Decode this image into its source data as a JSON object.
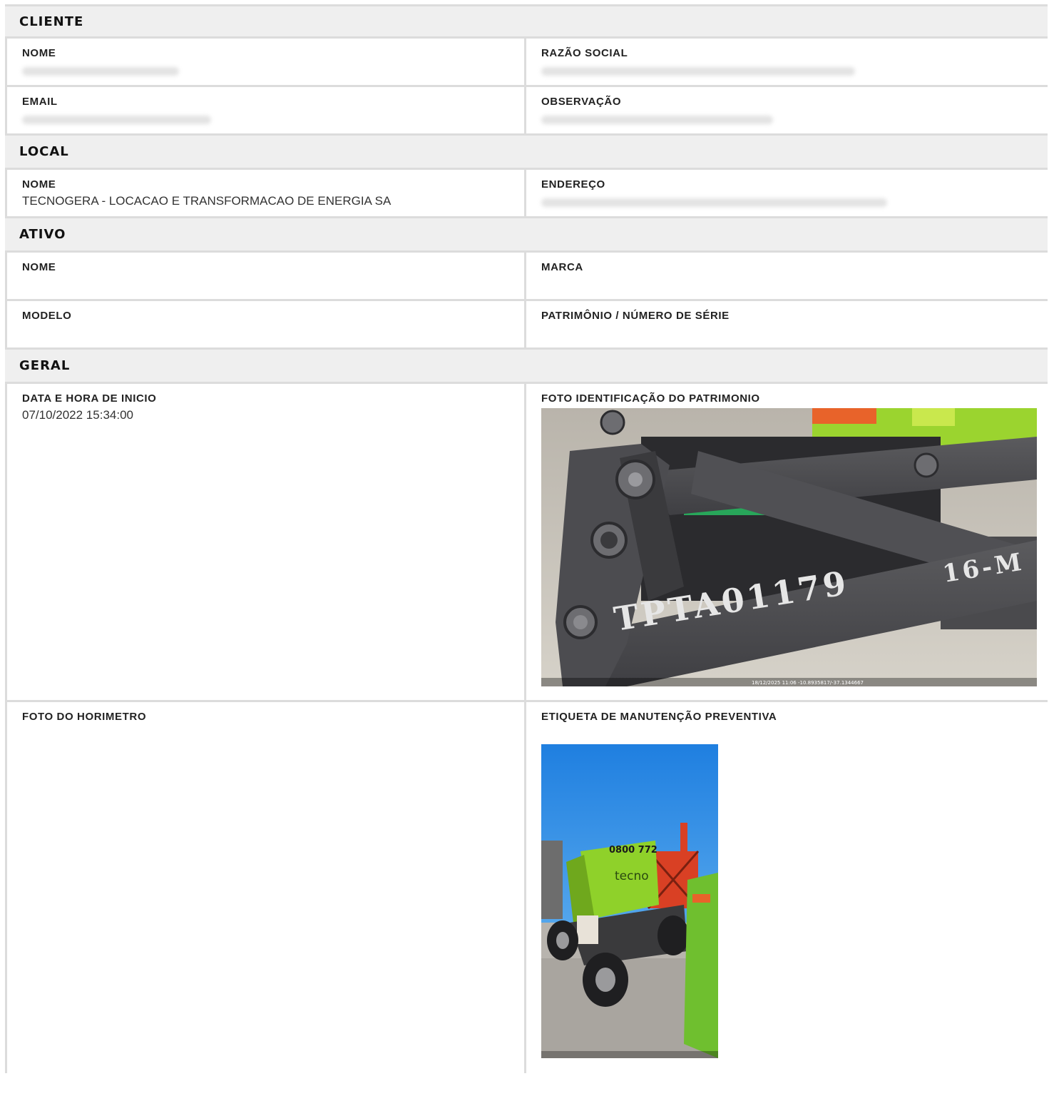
{
  "cliente": {
    "title": "CLIENTE",
    "nome_label": "NOME",
    "razao_label": "RAZÃO SOCIAL",
    "email_label": "EMAIL",
    "obs_label": "OBSERVAÇÃO"
  },
  "local": {
    "title": "LOCAL",
    "nome_label": "NOME",
    "nome_value": "TECNOGERA - LOCACAO E TRANSFORMACAO DE ENERGIA SA",
    "endereco_label": "ENDEREÇO"
  },
  "ativo": {
    "title": "ATIVO",
    "nome_label": "NOME",
    "marca_label": "MARCA",
    "modelo_label": "MODELO",
    "patrimonio_label": "PATRIMÔNIO / NÚMERO DE SÉRIE"
  },
  "geral": {
    "title": "GERAL",
    "data_label": "DATA E HORA DE INICIO",
    "data_value": "07/10/2022 15:34:00",
    "foto_id_label": "FOTO IDENTIFICAÇÃO DO PATRIMONIO",
    "foto_id_stencil": "TPTA01179",
    "foto_id_stencil2": "16-M",
    "foto_id_stamp": "18/12/2025 11:06 -10.8935817/-37.1344667",
    "horimetro_label": "FOTO DO HORIMETRO",
    "etiqueta_label": "ETIQUETA DE MANUTENÇÃO PREVENTIVA",
    "etiqueta_photo_text": "tecno",
    "etiqueta_photo_phone": "0800 772"
  },
  "colors": {
    "header_bg": "#efefef",
    "border": "#dcdcdc",
    "machine_green": "#8fd12a",
    "sky_blue": "#2f8fe8"
  }
}
